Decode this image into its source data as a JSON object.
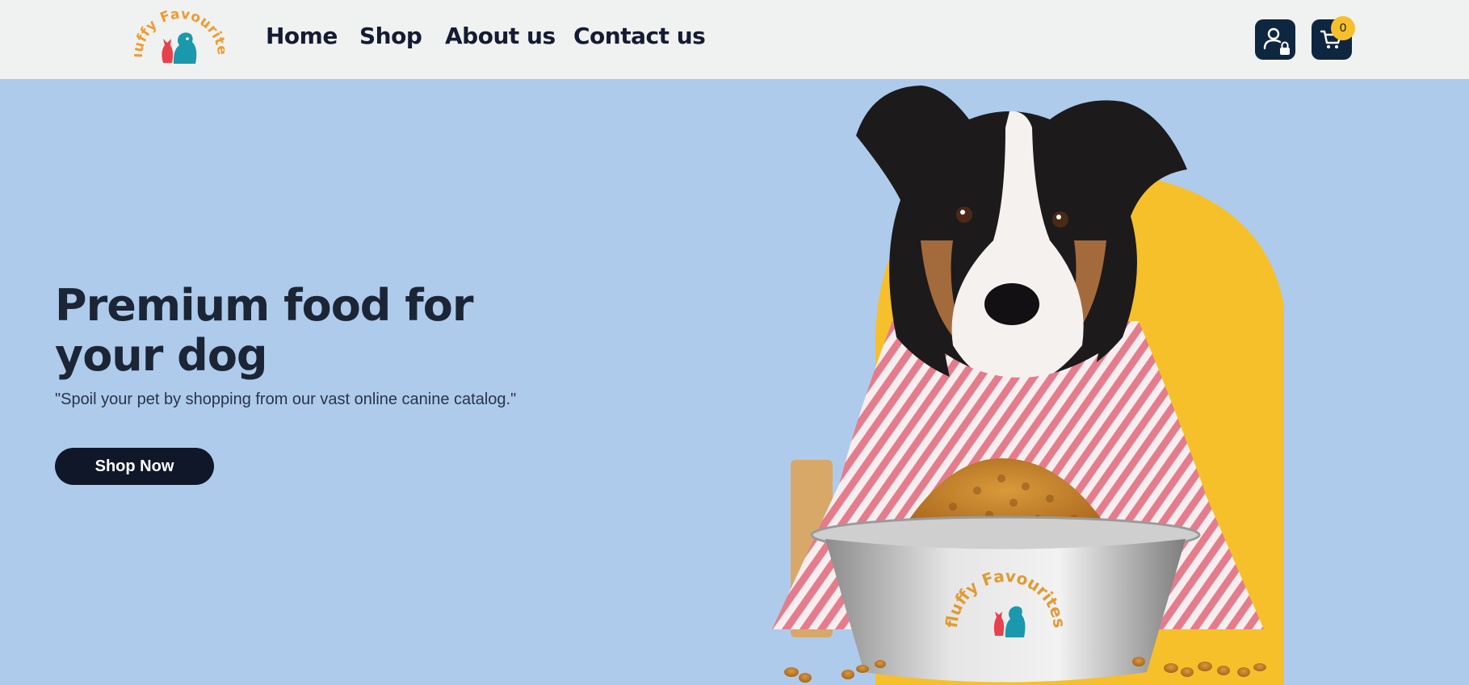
{
  "brand": {
    "logo_text": "fluffy Favourites"
  },
  "nav": {
    "items": [
      {
        "label": "Home"
      },
      {
        "label": "Shop"
      },
      {
        "label": "About us"
      },
      {
        "label": "Contact us"
      }
    ]
  },
  "header_actions": {
    "account_icon": "user-lock-icon",
    "cart_icon": "cart-icon",
    "cart_count": "0"
  },
  "hero": {
    "title": "Premium food for your dog",
    "subtitle": "\"Spoil your pet by shopping from our vast online canine catalog.\"",
    "cta_label": "Shop Now",
    "image_bowl_text": "fluffy Favourites"
  },
  "colors": {
    "page_bg": "#aecbec",
    "header_bg": "#f0f2f1",
    "dark_navy": "#0f2640",
    "accent_yellow": "#f6c02b",
    "brand_orange": "#f39a2e",
    "brand_teal": "#1a98ad",
    "brand_red": "#e8414e"
  }
}
